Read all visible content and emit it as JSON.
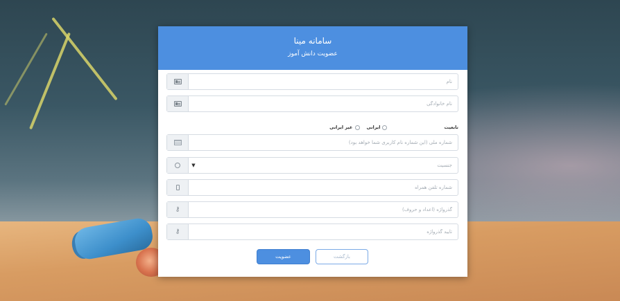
{
  "header": {
    "title": "سامانه مینا",
    "subtitle": "عضویت دانش آموز"
  },
  "form": {
    "first_name": {
      "placeholder": "نام",
      "icon": "id-card-icon"
    },
    "last_name": {
      "placeholder": "نام خانوادگی",
      "icon": "id-card-icon"
    },
    "nationality": {
      "label": "تابعیت",
      "options": [
        "ایرانی",
        "غیر ایرانی"
      ]
    },
    "national_code": {
      "placeholder": "شماره ملی (این شماره نام کاربری شما خواهد بود)",
      "icon": "id-document-icon"
    },
    "gender": {
      "placeholder": "جنسیت",
      "icon": "circle-icon"
    },
    "mobile": {
      "placeholder": "شماره تلفن همراه",
      "icon": "mobile-phone-icon"
    },
    "password": {
      "placeholder": "گذرواژه (اعداد و حروف)",
      "icon": "key-icon"
    },
    "password_confirm": {
      "placeholder": "تایید گذرواژه",
      "icon": "key-icon"
    }
  },
  "buttons": {
    "submit": "عضویت",
    "back": "بازگشت"
  },
  "colors": {
    "accent": "#4d8fe0"
  }
}
